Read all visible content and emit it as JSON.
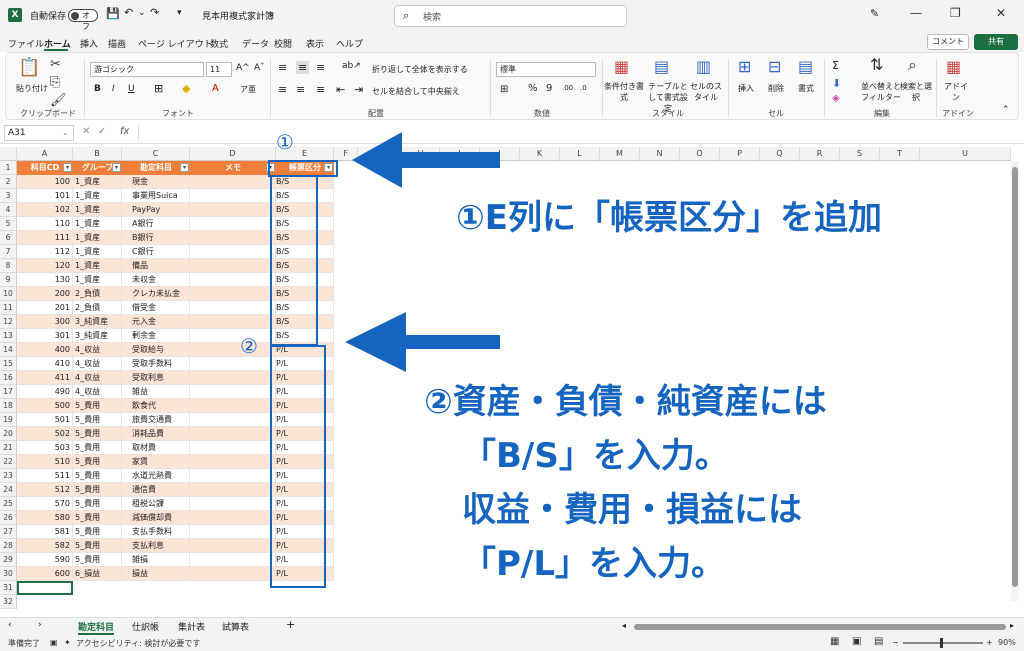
{
  "titlebar": {
    "autosave_label": "自動保存",
    "autosave_state": "オフ",
    "filename": "見本用複式家計簿",
    "search_placeholder": "検索"
  },
  "ribbon_tabs": [
    "ファイル",
    "ホーム",
    "挿入",
    "描画",
    "ページ レイアウト",
    "数式",
    "データ",
    "校閲",
    "表示",
    "ヘルプ"
  ],
  "actions": {
    "comment": "コメント",
    "share": "共有"
  },
  "ribbon": {
    "clipboard": {
      "paste": "貼り付け",
      "label": "クリップボード"
    },
    "font": {
      "name": "游ゴシック",
      "size": "11",
      "label": "フォント"
    },
    "alignment": {
      "wrap": "折り返して全体を表示する",
      "merge": "セルを結合して中央揃え",
      "label": "配置"
    },
    "number": {
      "format": "標準",
      "label": "数値"
    },
    "styles": {
      "conditional": "条件付き書式",
      "table": "テーブルとして書式設定",
      "cell": "セルのスタイル",
      "label": "スタイル"
    },
    "cells": {
      "insert": "挿入",
      "delete": "削除",
      "format": "書式",
      "label": "セル"
    },
    "editing": {
      "sortfilter": "並べ替えとフィルター",
      "find": "検索と選択",
      "label": "編集"
    },
    "addins": {
      "addin": "アドイン",
      "label": "アドイン"
    }
  },
  "formula_bar": {
    "name_box": "A31",
    "fx": "fx"
  },
  "sheet": {
    "columns": [
      "A",
      "B",
      "C",
      "D",
      "E",
      "F",
      "G",
      "H",
      "I",
      "J",
      "K",
      "L",
      "M",
      "N",
      "O",
      "P",
      "Q",
      "R",
      "S",
      "T",
      "U"
    ],
    "headers": [
      "科目CD",
      "グループ",
      "勘定科目",
      "メモ",
      "帳票区分"
    ],
    "rows": [
      [
        "100",
        "1_資産",
        "現金",
        "B/S"
      ],
      [
        "101",
        "1_資産",
        "事業用Suica",
        "B/S"
      ],
      [
        "102",
        "1_資産",
        "PayPay",
        "B/S"
      ],
      [
        "110",
        "1_資産",
        "A銀行",
        "B/S"
      ],
      [
        "111",
        "1_資産",
        "B銀行",
        "B/S"
      ],
      [
        "112",
        "1_資産",
        "C銀行",
        "B/S"
      ],
      [
        "120",
        "1_資産",
        "備品",
        "B/S"
      ],
      [
        "130",
        "1_資産",
        "未収金",
        "B/S"
      ],
      [
        "200",
        "2_負債",
        "クレカ未払金",
        "B/S"
      ],
      [
        "201",
        "2_負債",
        "借受金",
        "B/S"
      ],
      [
        "300",
        "3_純資産",
        "元入金",
        "B/S"
      ],
      [
        "301",
        "3_純資産",
        "剰余金",
        "B/S"
      ],
      [
        "400",
        "4_収益",
        "受取給与",
        "P/L"
      ],
      [
        "410",
        "4_収益",
        "受取手数料",
        "P/L"
      ],
      [
        "411",
        "4_収益",
        "受取利息",
        "P/L"
      ],
      [
        "490",
        "4_収益",
        "雑益",
        "P/L"
      ],
      [
        "500",
        "5_費用",
        "飲食代",
        "P/L"
      ],
      [
        "501",
        "5_費用",
        "旅費交通費",
        "P/L"
      ],
      [
        "502",
        "5_費用",
        "消耗品費",
        "P/L"
      ],
      [
        "503",
        "5_費用",
        "取材費",
        "P/L"
      ],
      [
        "510",
        "5_費用",
        "家賃",
        "P/L"
      ],
      [
        "511",
        "5_費用",
        "水道光熱費",
        "P/L"
      ],
      [
        "512",
        "5_費用",
        "通信費",
        "P/L"
      ],
      [
        "570",
        "5_費用",
        "租税公課",
        "P/L"
      ],
      [
        "580",
        "5_費用",
        "減価償却費",
        "P/L"
      ],
      [
        "581",
        "5_費用",
        "支払手数料",
        "P/L"
      ],
      [
        "582",
        "5_費用",
        "支払利息",
        "P/L"
      ],
      [
        "590",
        "5_費用",
        "雑損",
        "P/L"
      ],
      [
        "600",
        "6_損益",
        "損益",
        "P/L"
      ]
    ],
    "row_numbers": [
      "1",
      "2",
      "3",
      "4",
      "5",
      "6",
      "7",
      "8",
      "9",
      "10",
      "11",
      "12",
      "13",
      "14",
      "15",
      "16",
      "17",
      "18",
      "19",
      "20",
      "21",
      "22",
      "23",
      "24",
      "25",
      "26",
      "27",
      "28",
      "29",
      "30",
      "31",
      "32"
    ]
  },
  "annotations": {
    "marker1": "①",
    "marker2": "②",
    "note1": "①E列に「帳票区分」を追加",
    "note2_lines": [
      "②資産・負債・純資産には",
      "「B/S」を入力。",
      "収益・費用・損益には",
      "「P/L」を入力。"
    ]
  },
  "sheet_tabs": [
    "勘定科目",
    "仕訳帳",
    "集計表",
    "試算表"
  ],
  "status": {
    "ready": "準備完了",
    "accessibility": "アクセシビリティ: 検討が必要です",
    "zoom": "90%"
  },
  "colors": {
    "header_orange": "#f07f3c",
    "band_light": "#fce4d6",
    "annotation_blue": "#1565c0",
    "excel_green": "#1d6f42"
  }
}
